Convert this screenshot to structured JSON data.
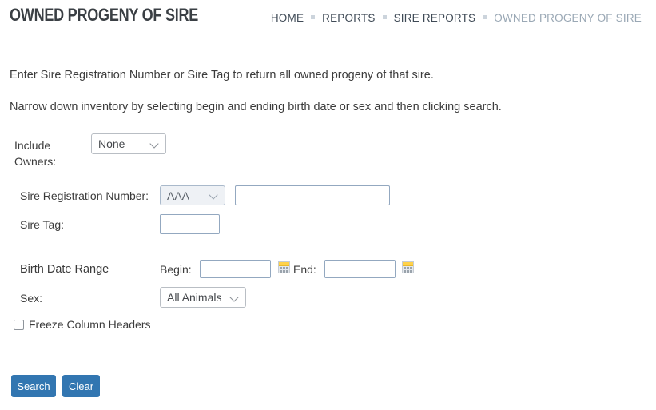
{
  "header": {
    "title": "OWNED PROGENY OF SIRE",
    "breadcrumb": {
      "items": [
        {
          "label": "HOME",
          "current": false
        },
        {
          "label": "REPORTS",
          "current": false
        },
        {
          "label": "SIRE REPORTS",
          "current": false
        },
        {
          "label": "OWNED PROGENY OF SIRE",
          "current": true
        }
      ],
      "separator_icon": "square-dot-separator-icon"
    }
  },
  "intro": {
    "line1": "Enter Sire Registration Number or Sire Tag to return all owned progeny of that sire.",
    "line2": "Narrow down inventory by selecting begin and ending birth date or sex and then clicking search."
  },
  "form": {
    "include_owners": {
      "label": "Include Owners:",
      "value": "None",
      "options": [
        "None"
      ]
    },
    "sire_registration_number": {
      "label": "Sire Registration Number:",
      "association": {
        "value": "AAA",
        "options": [
          "AAA"
        ]
      },
      "number": {
        "value": "",
        "placeholder": ""
      }
    },
    "sire_tag": {
      "label": "Sire Tag:",
      "value": "",
      "placeholder": ""
    },
    "birth_date_range": {
      "label": "Birth Date Range",
      "begin": {
        "label": "Begin:",
        "value": "",
        "placeholder": "",
        "calendar_icon": "calendar-icon"
      },
      "end": {
        "label": "End:",
        "value": "",
        "placeholder": "",
        "calendar_icon": "calendar-icon"
      }
    },
    "sex": {
      "label": "Sex:",
      "value": "All Animals",
      "options": [
        "All Animals"
      ]
    },
    "freeze_column_headers": {
      "label": "Freeze Column Headers",
      "checked": false
    }
  },
  "actions": {
    "search_label": "Search",
    "clear_label": "Clear"
  },
  "colors": {
    "accent_button": "#3276b1",
    "title_text": "#3a3f44",
    "breadcrumb_current": "#9aa8b5",
    "input_border": "#93a8c0",
    "calendar_header": "#ffd24a"
  }
}
